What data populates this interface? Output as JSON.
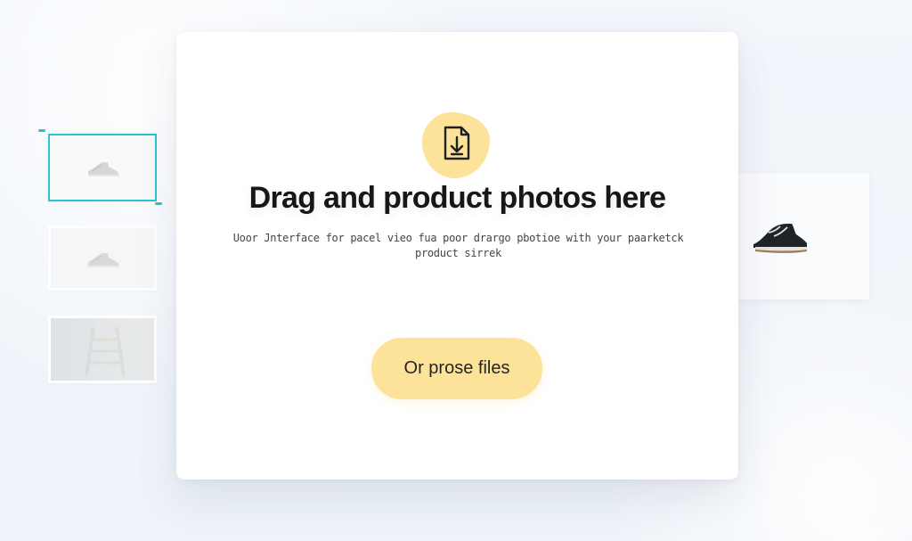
{
  "icons": {
    "upload": "file-download-icon",
    "shoe": "sneaker-icon",
    "ladder": "ladder-icon"
  },
  "colors": {
    "background": "#eef3f9",
    "modal": "#ffffff",
    "accent": "#fde39a",
    "selection": "#2dc2cf",
    "text": "#171717"
  },
  "modal": {
    "title": "Drag and product photos here",
    "subtitle": "Uoor Jnterface for pacel vieo fua poor drargo pbotioe with your paarketck product sirrek",
    "button_label": "Or prose files"
  }
}
